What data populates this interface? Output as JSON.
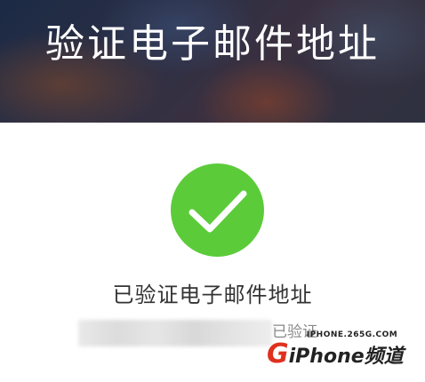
{
  "header": {
    "title": "验证电子邮件地址"
  },
  "status": {
    "icon": "checkmark-icon",
    "icon_color": "#5ccb3a",
    "message": "已验证电子邮件地址",
    "verified_suffix": "已验证"
  },
  "watermark": {
    "url": "IPHONE.265G.COM",
    "logo_letter": "G",
    "logo_text": "iPhone频道",
    "accent_color": "#e0301e"
  }
}
